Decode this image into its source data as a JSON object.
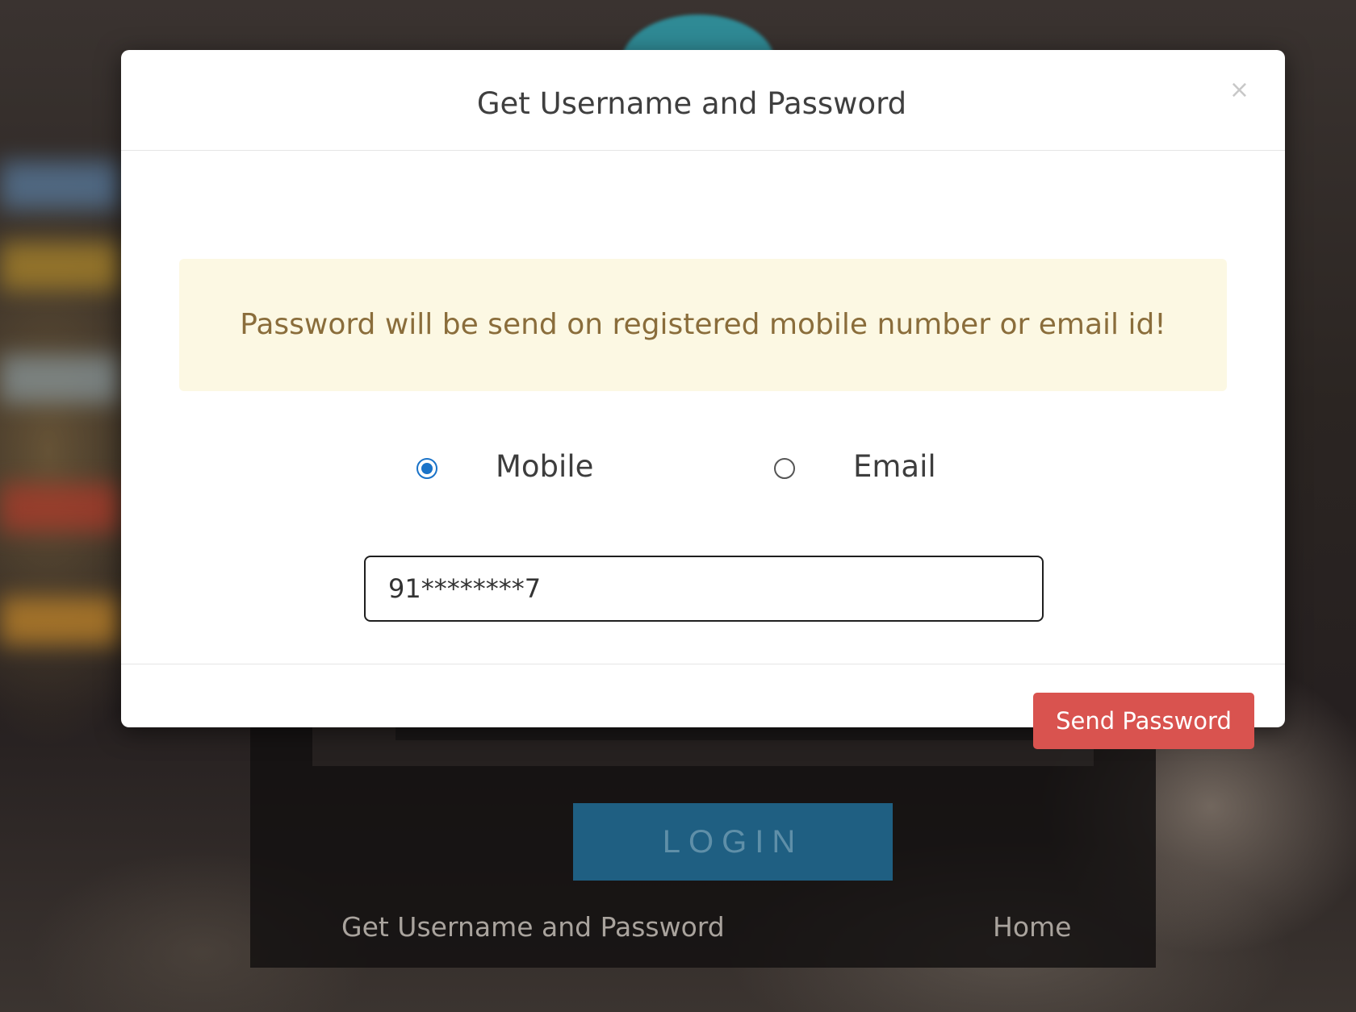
{
  "modal": {
    "title": "Get Username and Password",
    "close_label": "×",
    "alert_text": "Password will be send on registered mobile number or email id!",
    "options": [
      {
        "label": "Mobile",
        "selected": true
      },
      {
        "label": "Email",
        "selected": false
      }
    ],
    "input_value": "91********7",
    "send_button": "Send Password"
  },
  "background": {
    "login_button": "LOGIN",
    "links": [
      "Get Username and Password",
      "Home"
    ]
  },
  "colors": {
    "alert_bg": "#fcf8e3",
    "alert_text": "#8a6d3b",
    "send_button": "#d9534f",
    "radio_accent": "#1a73c8",
    "login_button": "#1f5f82"
  }
}
